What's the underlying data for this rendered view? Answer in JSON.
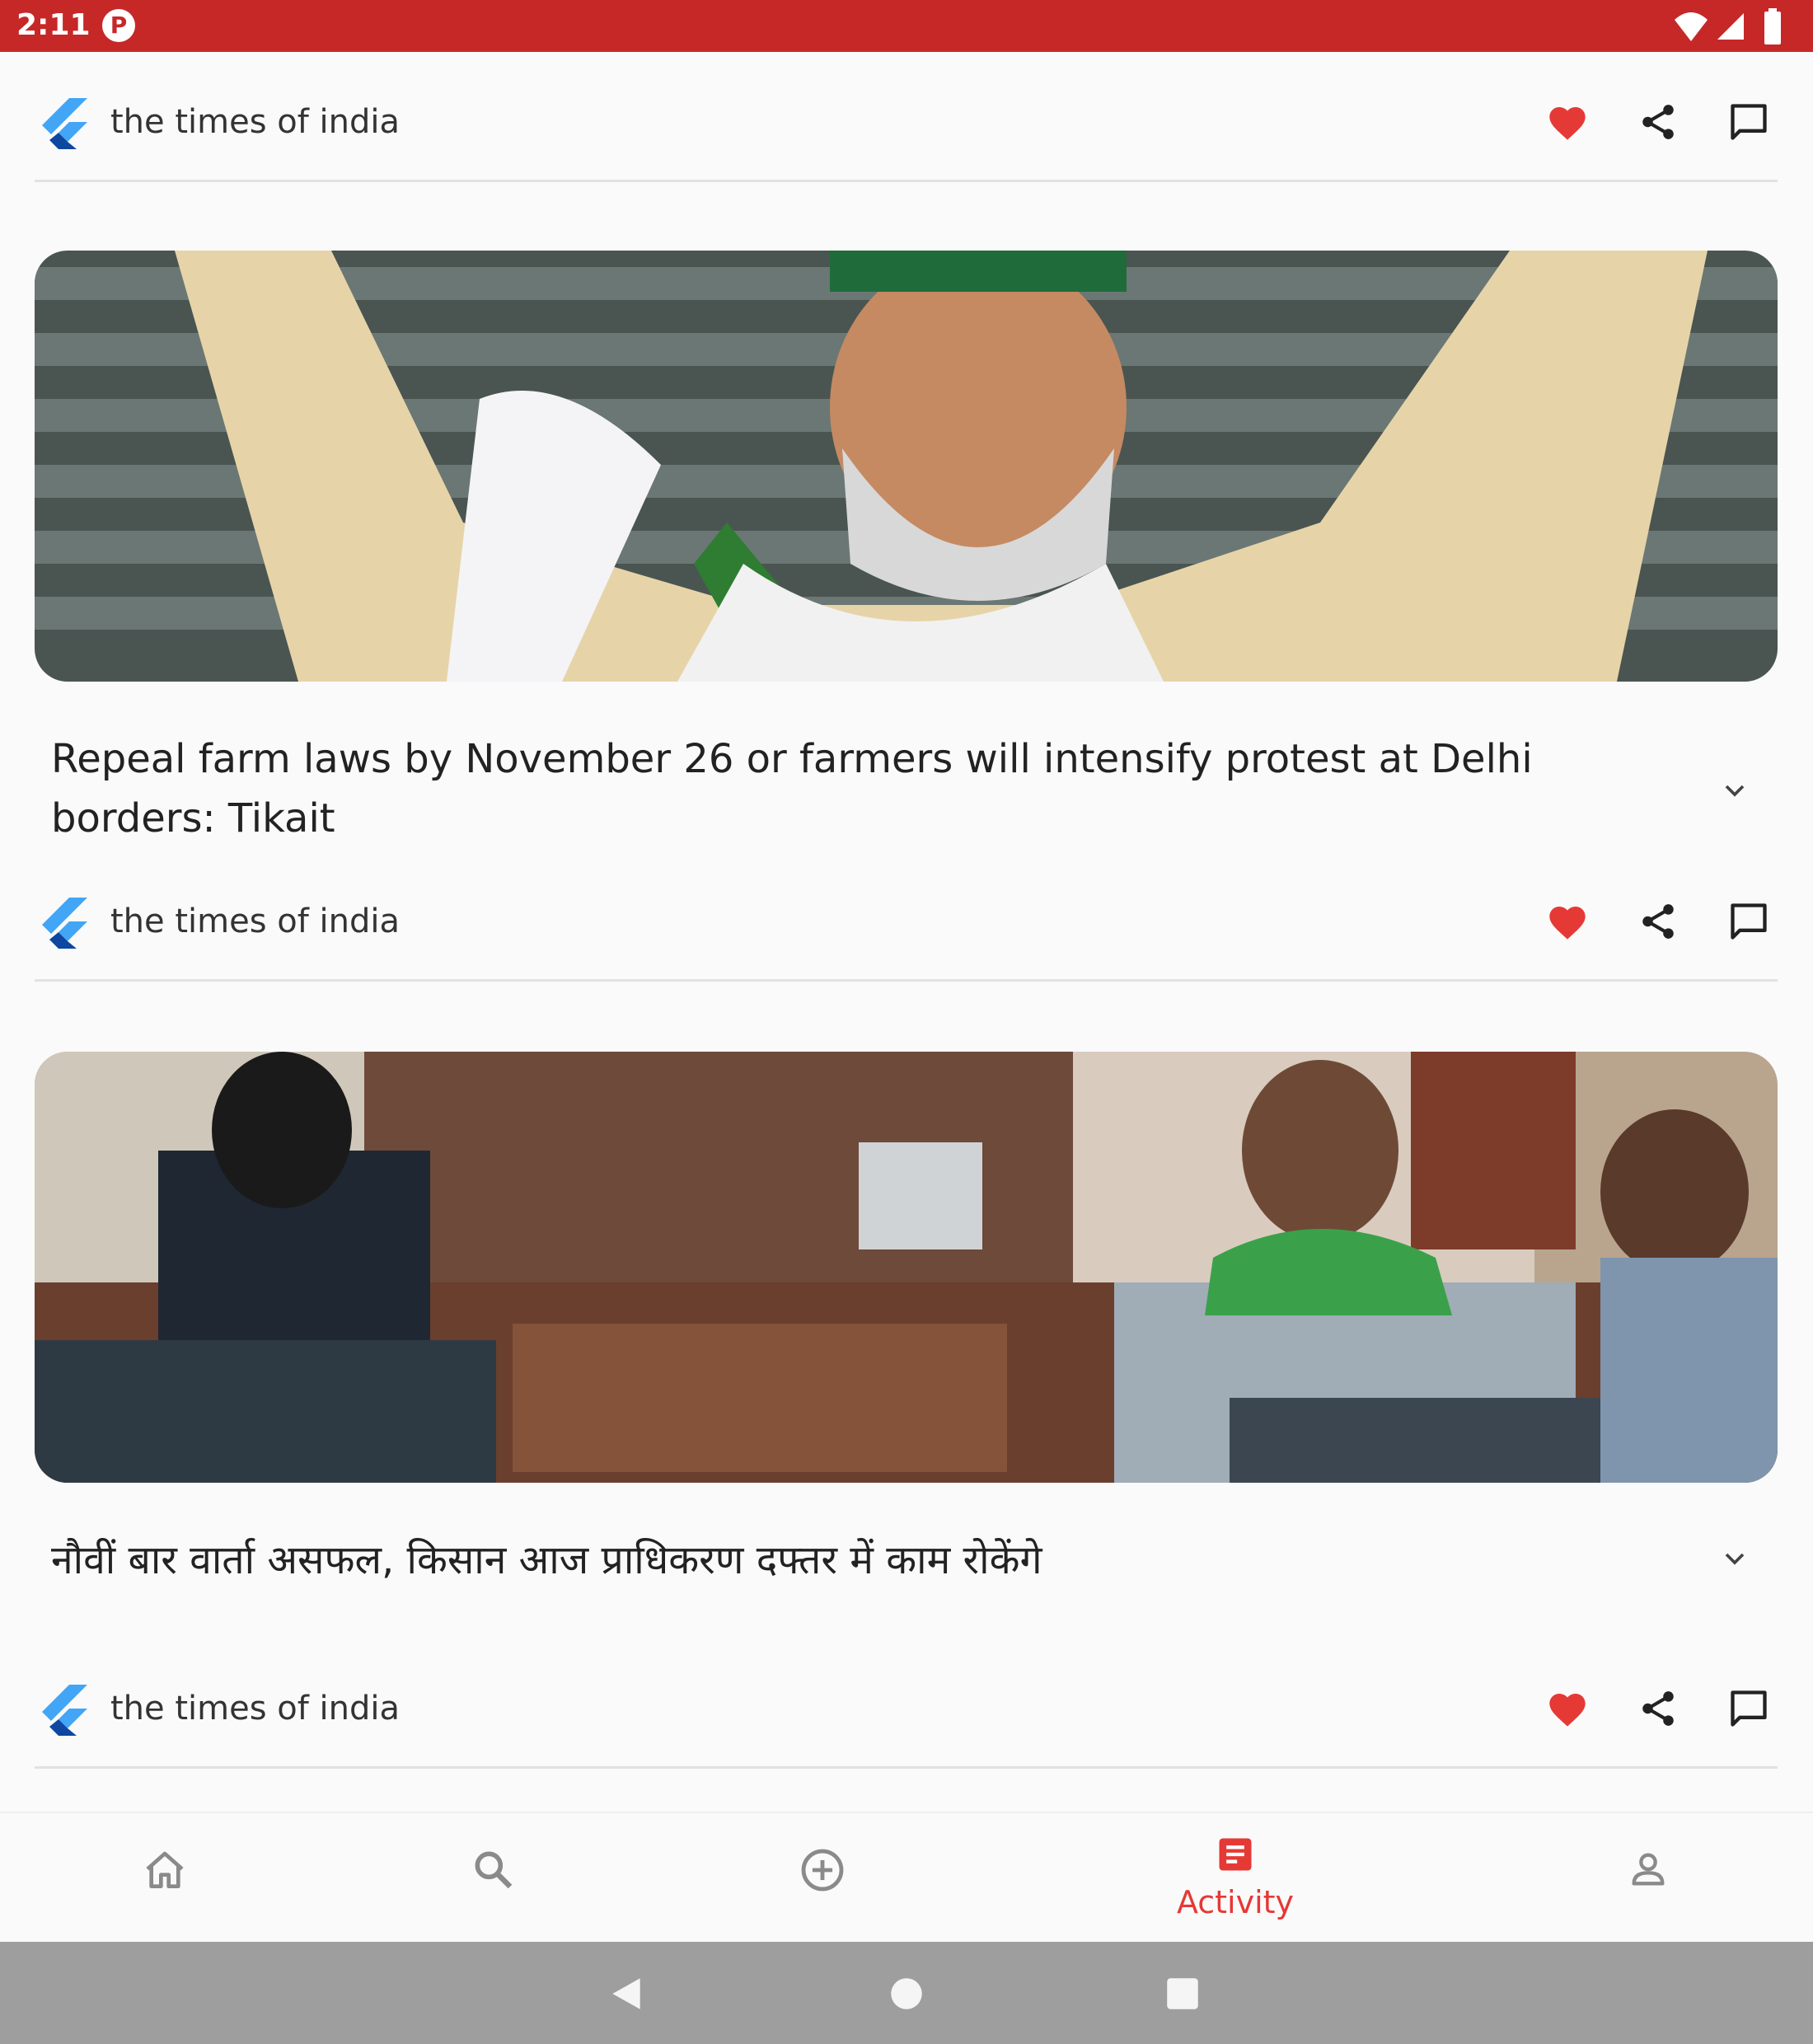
{
  "status_bar": {
    "time": "2:11",
    "app_icon_glyph": "P"
  },
  "colors": {
    "accent": "#e53935",
    "status_bar": "#c62828",
    "heart": "#e53935"
  },
  "feed": {
    "items": [
      {
        "source": "the times of india",
        "headline": "Repeal farm laws by November 26 or farmers will intensify protest at Delhi borders: Tikait",
        "image_description_icon": "photo-farmer-leader"
      },
      {
        "source": "the times of india",
        "headline": "नौवीं बार वार्ता असफल, किसान आज प्राधिकरण दफ्तर में काम रोकेंगे",
        "image_description_icon": "photo-meeting-office"
      },
      {
        "source": "the times of india"
      }
    ]
  },
  "bottom_nav": {
    "items": [
      {
        "icon": "home-icon",
        "label": ""
      },
      {
        "icon": "search-icon",
        "label": ""
      },
      {
        "icon": "add-circle-icon",
        "label": ""
      },
      {
        "icon": "activity-icon",
        "label": "Activity",
        "active": true
      },
      {
        "icon": "profile-icon",
        "label": ""
      }
    ]
  }
}
